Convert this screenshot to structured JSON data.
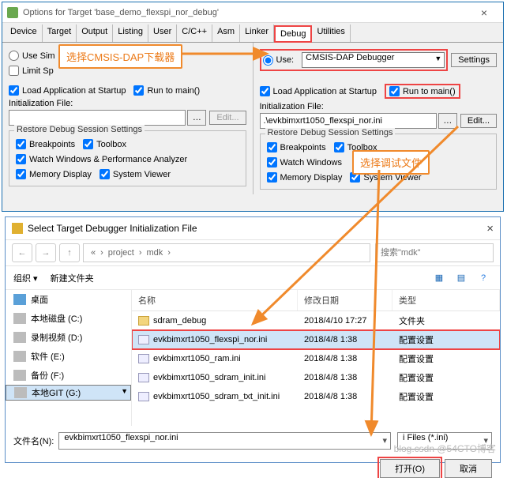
{
  "win1": {
    "title": "Options for Target 'base_demo_flexspi_nor_debug'",
    "tabs": [
      "Device",
      "Target",
      "Output",
      "Listing",
      "User",
      "C/C++",
      "Asm",
      "Linker",
      "Debug",
      "Utilities"
    ],
    "left": {
      "useSim": "Use Sim",
      "limitSp": "Limit Sp",
      "loadApp": "Load Application at Startup",
      "runMain": "Run to main()",
      "initFile": "Initialization File:",
      "edit": "Edit...",
      "restore": "Restore Debug Session Settings",
      "bp": "Breakpoints",
      "tb": "Toolbox",
      "ww": "Watch Windows & Performance Analyzer",
      "md": "Memory Display",
      "sv": "System Viewer"
    },
    "right": {
      "use": "Use:",
      "debugger": "CMSIS-DAP Debugger",
      "settings": "Settings",
      "loadApp": "Load Application at Startup",
      "runMain": "Run to main()",
      "initFile": "Initialization File:",
      "initVal": ".\\evkbimxrt1050_flexspi_nor.ini",
      "edit": "Edit...",
      "restore": "Restore Debug Session Settings",
      "bp": "Breakpoints",
      "tb": "Toolbox",
      "ww": "Watch Windows",
      "md": "Memory Display",
      "sv": "System Viewer"
    }
  },
  "annot": {
    "a1": "选择CMSIS-DAP下载器",
    "a2": "选择调试文件"
  },
  "win2": {
    "title": "Select Target Debugger Initialization File",
    "crumbs": [
      "«",
      "project",
      "mdk"
    ],
    "searchPh": "搜索\"mdk\"",
    "org": "组织 ▾",
    "newf": "新建文件夹",
    "side": [
      {
        "label": "桌面"
      },
      {
        "label": "本地磁盘 (C:)"
      },
      {
        "label": "录制视频 (D:)"
      },
      {
        "label": "软件 (E:)"
      },
      {
        "label": "备份 (F:)"
      },
      {
        "label": "本地GIT (G:)"
      }
    ],
    "cols": {
      "c1": "名称",
      "c2": "修改日期",
      "c3": "类型"
    },
    "rows": [
      {
        "name": "sdram_debug",
        "date": "2018/4/10 17:27",
        "type": "文件夹",
        "folder": true
      },
      {
        "name": "evkbimxrt1050_flexspi_nor.ini",
        "date": "2018/4/8 1:38",
        "type": "配置设置"
      },
      {
        "name": "evkbimxrt1050_ram.ini",
        "date": "2018/4/8 1:38",
        "type": "配置设置"
      },
      {
        "name": "evkbimxrt1050_sdram_init.ini",
        "date": "2018/4/8 1:38",
        "type": "配置设置"
      },
      {
        "name": "evkbimxrt1050_sdram_txt_init.ini",
        "date": "2018/4/8 1:38",
        "type": "配置设置"
      }
    ],
    "fnLabel": "文件名(N):",
    "fnVal": "evkbimxrt1050_flexspi_nor.ini",
    "filter": "i Files (*.ini)",
    "open": "打开(O)",
    "cancel": "取消"
  },
  "watermark": "blog.csdn @54CTO博客"
}
